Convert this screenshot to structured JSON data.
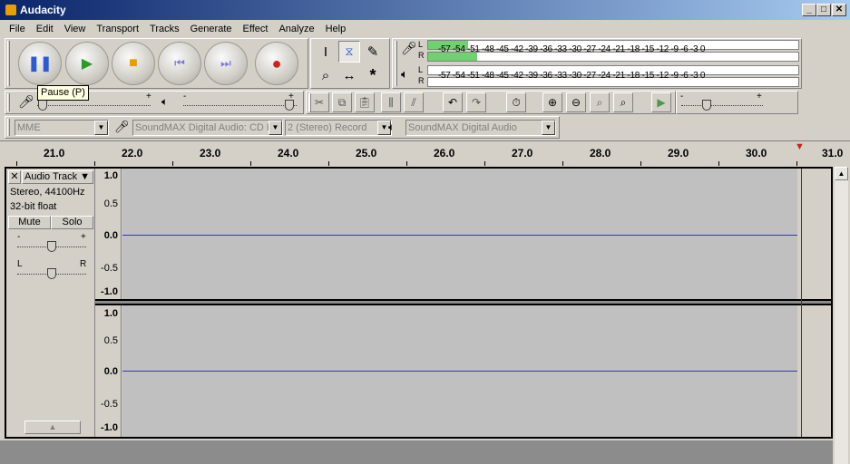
{
  "window": {
    "title": "Audacity",
    "minimize": "_",
    "maximize": "□",
    "close": "✕"
  },
  "menu": [
    "File",
    "Edit",
    "View",
    "Transport",
    "Tracks",
    "Generate",
    "Effect",
    "Analyze",
    "Help"
  ],
  "tooltip": "Pause (P)",
  "meters": {
    "labels": "-57 -54 -51 -48 -45 -42 -39 -36 -33 -30 -27 -24 -21 -18 -15 -12  -9  -6  -3  0",
    "L": "L",
    "R": "R"
  },
  "device": {
    "host": "MME",
    "input": "SoundMAX Digital Audio: CD Pl",
    "channels": "2 (Stereo) Record",
    "output": "SoundMAX Digital Audio"
  },
  "ruler": [
    "21.0",
    "22.0",
    "23.0",
    "24.0",
    "25.0",
    "26.0",
    "27.0",
    "28.0",
    "29.0",
    "30.0",
    "31.0"
  ],
  "track": {
    "name": "Audio Track",
    "info1": "Stereo, 44100Hz",
    "info2": "32-bit float",
    "mute": "Mute",
    "solo": "Solo",
    "gain_minus": "-",
    "gain_plus": "+",
    "pan_left": "L",
    "pan_right": "R",
    "scale": [
      "1.0",
      "0.5",
      "0.0",
      "-0.5",
      "-1.0"
    ],
    "close": "✕",
    "menu_arrow": "▼",
    "collapse": "▲"
  },
  "mixer": {
    "minus": "-",
    "plus": "+"
  },
  "colors": {
    "meter_green": "#6fd16f",
    "waveform_line": "#3333cc",
    "cursor": "#cc0000"
  }
}
